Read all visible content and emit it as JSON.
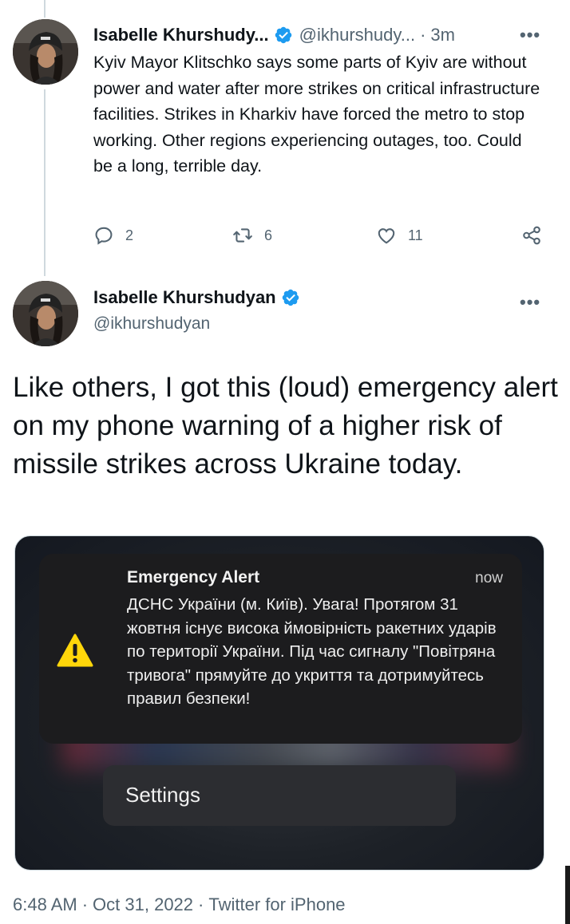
{
  "parent_tweet": {
    "name": "Isabelle Khurshudy...",
    "handle": "@ikhurshudy...",
    "separator": "·",
    "time": "3m",
    "more": "•••",
    "text": "Kyiv Mayor Klitschko says some parts of Kyiv are without power and water after more strikes on critical infrastructure facilities. Strikes in Kharkiv have forced the metro to stop working. Other regions experiencing outages, too. Could be a long, terrible day.",
    "replies": "2",
    "retweets": "6",
    "likes": "11"
  },
  "main_tweet": {
    "name": "Isabelle Khurshudyan",
    "handle": "@ikhurshudyan",
    "more": "•••",
    "text": "Like others, I got this (loud) emergency alert on my phone warning of a higher risk of missile strikes across Ukraine today.",
    "media": {
      "alert_title": "Emergency Alert",
      "alert_time": "now",
      "alert_text": "ДСНС України (м. Київ). Увага! Протягом 31 жовтня існує висока ймовірність ракетних ударів по території України. Під час сигналу \"Повітряна тривога\" прямуйте до укриття та дотримуйтесь правил безпеки!",
      "settings_label": "Settings"
    },
    "timestamp": "6:48 AM",
    "date": "Oct 31, 2022",
    "source": "Twitter for iPhone",
    "meta_separator": "·"
  },
  "colors": {
    "verified": "#1d9bf0",
    "secondary_text": "#536471",
    "warning": "#ffd60a"
  },
  "icons": [
    "verified-badge-icon",
    "reply-icon",
    "retweet-icon",
    "like-icon",
    "share-icon",
    "warning-icon",
    "more-icon"
  ]
}
